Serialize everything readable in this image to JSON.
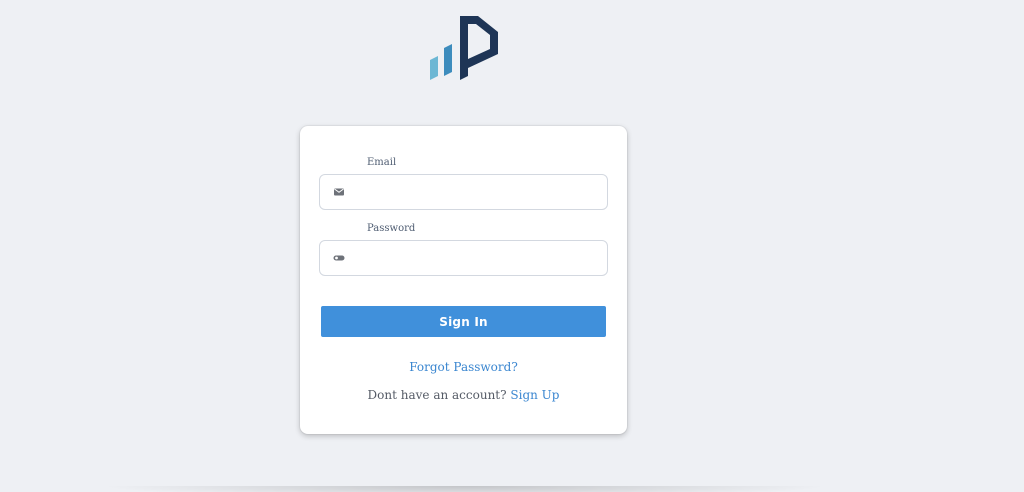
{
  "logo": {
    "icon": "brand-logo-icon",
    "colors": {
      "bar_light": "#6cb7d4",
      "bar_mid": "#3d8cbd",
      "mark_dark": "#1e3556"
    }
  },
  "login": {
    "email_label": "Email",
    "email_icon": "envelope-icon",
    "email_value": "",
    "email_placeholder": "",
    "password_label": "Password",
    "password_icon": "key-icon",
    "password_value": "",
    "password_placeholder": "",
    "signin_label": "Sign In",
    "forgot_label": "Forgot Password?",
    "no_account_text": "Dont have an account?",
    "signup_label": "Sign Up"
  },
  "colors": {
    "background": "#eef0f4",
    "accent": "#4090db",
    "link": "#3a86d0"
  }
}
